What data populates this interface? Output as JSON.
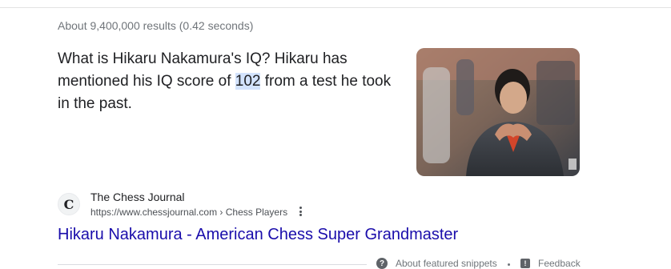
{
  "results_stats": "About 9,400,000 results (0.42 seconds)",
  "snippet": {
    "before": "What is Hikaru Nakamura's IQ? Hikaru has mentioned his IQ score of ",
    "highlight": "102",
    "after": " from a test he took in the past."
  },
  "source": {
    "favicon_letter": "C",
    "site_name": "The Chess Journal",
    "url": "https://www.chessjournal.com › Chess Players"
  },
  "result": {
    "title": "Hikaru Nakamura - American Chess Super Grandmaster"
  },
  "footer": {
    "about_label": "About featured snippets",
    "feedback_label": "Feedback"
  },
  "colors": {
    "link": "#1a0dab",
    "highlight": "#d3e3fd",
    "text": "#202124",
    "muted": "#70757a"
  },
  "icons": {
    "menu": "three-dots-vertical-icon",
    "about": "question-circle-icon",
    "feedback": "feedback-flag-icon"
  }
}
